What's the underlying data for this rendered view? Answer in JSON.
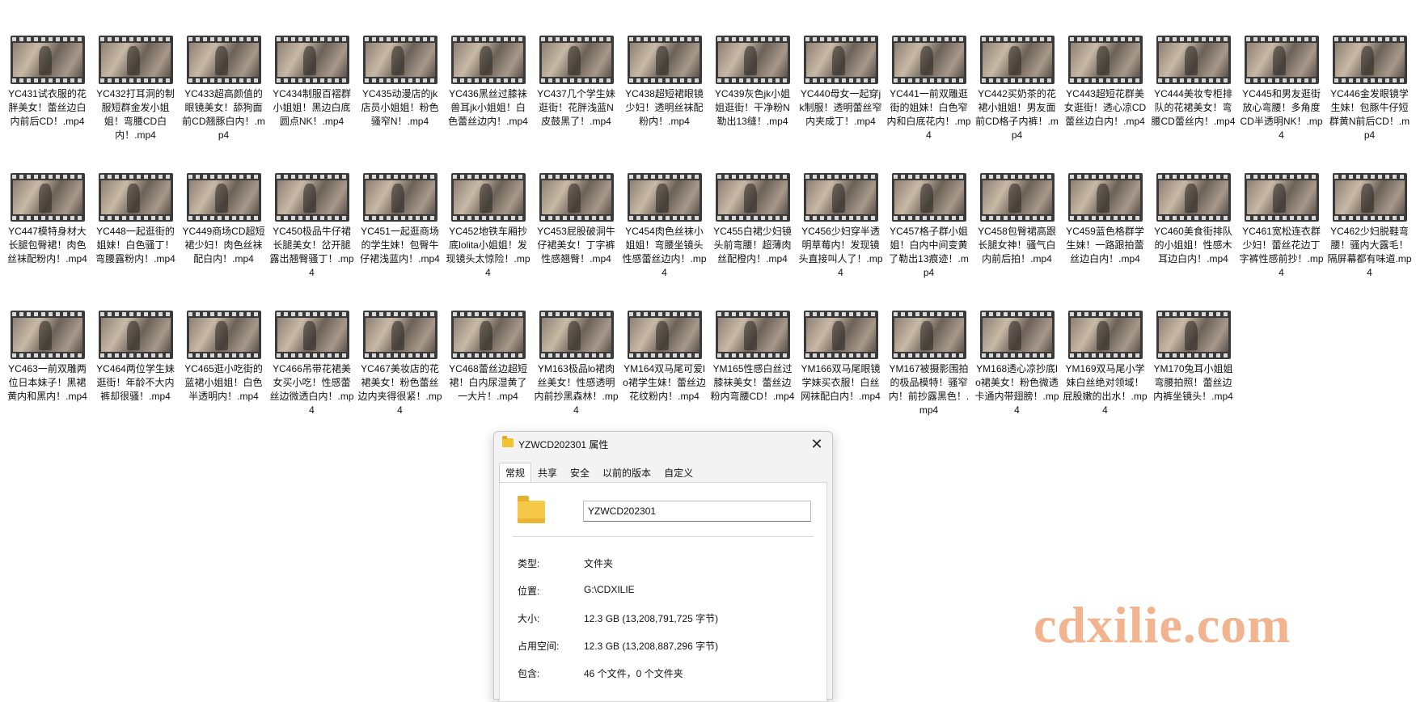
{
  "files": [
    "YC431试衣服的花胖美女！蕾丝边白内前后CD！.mp4",
    "YC432打耳洞的制服短群金发小姐姐！弯腰CD白内！.mp4",
    "YC433超高颜值的眼镜美女！舔狗面前CD翘豚白内！.mp4",
    "YC434制服百褶群小姐姐！黑边白底圆点NK！.mp4",
    "YC435动漫店的jk店员小姐姐！粉色骚窄N！.mp4",
    "YC436黑丝过膝袜兽耳jk小姐姐！白色蕾丝边内！.mp4",
    "YC437几个学生妹逛街！花胖浅蓝N皮鼓黑了！.mp4",
    "YC438超短裙眼镜少妇！透明丝袜配粉内！.mp4",
    "YC439灰色jk小姐姐逛街！干净粉N勒出13缝！.mp4",
    "YC440母女一起穿jk制服！透明蕾丝窄内夹成丁！.mp4",
    "YC441一前双雕逛街的姐妹！白色窄内和白底花内！.mp4",
    "YC442买奶茶的花裙小姐姐！男友面前CD格子内裤！.mp4",
    "YC443超短花群美女逛街！透心凉CD蕾丝边白内！.mp4",
    "YC444美妆专柜排队的花裙美女！弯腰CD蕾丝内！.mp4",
    "YC445和男友逛街放心弯腰！多角度CD半透明NK！.mp4",
    "YC446金发眼镜学生妹！包豚牛仔短群黄N前后CD！.mp4",
    "YC447模特身材大长腿包臀裙！肉色丝袜配粉内！.mp4",
    "YC448一起逛街的姐妹！白色骚丁！弯腰露粉内！.mp4",
    "YC449商场CD超短裙少妇！肉色丝袜配白内！.mp4",
    "YC450极品牛仔裙长腿美女！岔开腿露出翘臀骚丁！.mp4",
    "YC451一起逛商场的学生妹！包臀牛仔裙浅蓝内！.mp4",
    "YC452地铁车厢抄底lolita小姐姐！发现镜头太惊险！.mp4",
    "YC453屁股破洞牛仔裙美女！丁字裤性感翘臀！.mp4",
    "YC454肉色丝袜小姐姐！弯腰坐镜头性感蕾丝边内！.mp4",
    "YC455白裙少妇镜头前弯腰！超薄肉丝配橙内！.mp4",
    "YC456少妇穿半透明草莓内！发现镜头直接叫人了！.mp4",
    "YC457格子群小姐姐！白内中间变黄了勒出13痕迹！.mp4",
    "YC458包臀裙高跟长腿女神！骚气白内前后拍！.mp4",
    "YC459蓝色格群学生妹！一路跟拍蕾丝边白内！.mp4",
    "YC460美食街排队的小姐姐！性感木耳边白内！.mp4",
    "YC461宽松连衣群少妇！蕾丝花边丁字裤性感前抄！.mp4",
    "YC462少妇脱鞋弯腰！骚内大露毛！隔屏幕都有味道.mp4",
    "YC463一前双雕两位日本妹子！黑裙黄内和黑内！.mp4",
    "YC464两位学生妹逛街！年龄不大内裤却很骚！.mp4",
    "YC465逛小吃街的蓝裙小姐姐！白色半透明内！.mp4",
    "YC466吊带花裙美女买小吃！性感蕾丝边微透白内！.mp4",
    "YC467美妆店的花裙美女！粉色蕾丝边内夹得很紧！.mp4",
    "YC468蕾丝边超短裙！白内尿湿黄了一大片！.mp4",
    "YM163极品lo裙肉丝美女！性感透明内前抄黑森林！.mp4",
    "YM164双马尾可爱lo裙学生妹！蕾丝边花纹粉内！.mp4",
    "YM165性感白丝过膝袜美女！蕾丝边粉内弯腰CD！.mp4",
    "YM166双马尾眼镜学妹买衣服！白丝网袜配白内！.mp4",
    "YM167被摄影围拍的极品模特！骚窄内！前抄露黑色！.mp4",
    "YM168透心凉抄底lo裙美女！粉色微透卡通内带翅膀！.mp4",
    "YM169双马尾小学妹白丝绝对领域！屁股嫩的出水！.mp4",
    "YM170兔耳小姐姐弯腰拍照！蕾丝边内裤坐镜头！.mp4"
  ],
  "dialog": {
    "title": "YZWCD202301 属性",
    "close": "✕",
    "tabs": [
      "常规",
      "共享",
      "安全",
      "以前的版本",
      "自定义"
    ],
    "name_value": "YZWCD202301",
    "props": [
      {
        "label": "类型:",
        "value": "文件夹"
      },
      {
        "label": "位置:",
        "value": "G:\\CDXILIE"
      },
      {
        "label": "大小:",
        "value": "12.3 GB (13,208,791,725 字节)"
      },
      {
        "label": "占用空间:",
        "value": "12.3 GB (13,208,887,296 字节)"
      },
      {
        "label": "包含:",
        "value": "46 个文件，0 个文件夹"
      }
    ]
  },
  "watermark": "cdxilie.com"
}
